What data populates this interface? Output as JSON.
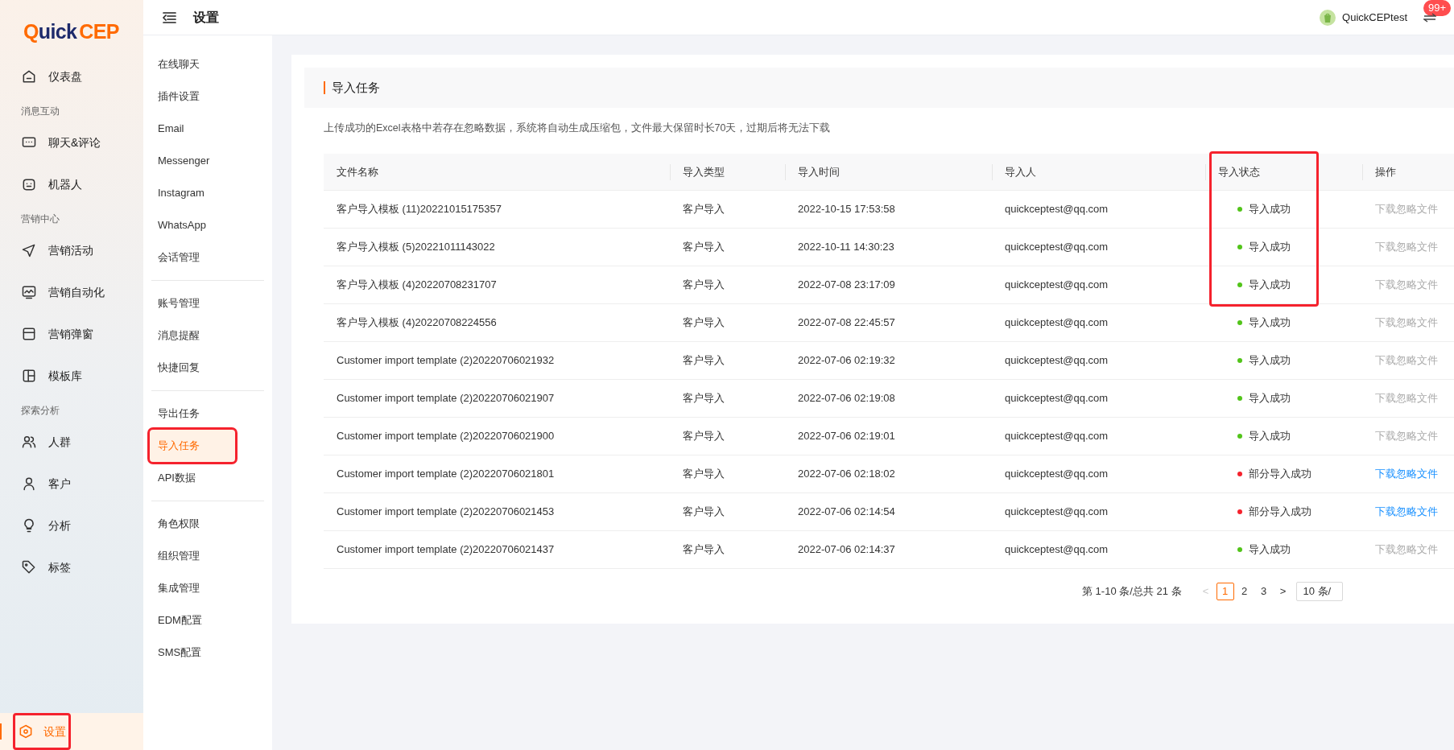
{
  "logo": {
    "first": "Q",
    "middle": "uick",
    "last": "CEP"
  },
  "sidebar": {
    "items": [
      {
        "kind": "item",
        "label": "仪表盘",
        "selected": false,
        "annotated": false
      },
      {
        "kind": "group",
        "label": "消息互动"
      },
      {
        "kind": "item",
        "label": "聊天&评论",
        "selected": false,
        "annotated": false
      },
      {
        "kind": "item",
        "label": "机器人",
        "selected": false,
        "annotated": false
      },
      {
        "kind": "group",
        "label": "营销中心"
      },
      {
        "kind": "item",
        "label": "营销活动",
        "selected": false,
        "annotated": false
      },
      {
        "kind": "item",
        "label": "营销自动化",
        "selected": false,
        "annotated": false
      },
      {
        "kind": "item",
        "label": "营销弹窗",
        "selected": false,
        "annotated": false
      },
      {
        "kind": "item",
        "label": "模板库",
        "selected": false,
        "annotated": false
      },
      {
        "kind": "group",
        "label": "探索分析"
      },
      {
        "kind": "item",
        "label": "人群",
        "selected": false,
        "annotated": false
      },
      {
        "kind": "item",
        "label": "客户",
        "selected": false,
        "annotated": false
      },
      {
        "kind": "item",
        "label": "分析",
        "selected": false,
        "annotated": false
      },
      {
        "kind": "item",
        "label": "标签",
        "selected": false,
        "annotated": false
      }
    ],
    "footer_item": {
      "label": "设置",
      "selected": true,
      "annotated": true
    }
  },
  "header": {
    "title": "设置",
    "shop": "QuickCEPtest",
    "badge": "99+"
  },
  "subnav": {
    "groups": [
      [
        {
          "label": "在线聊天",
          "selected": false,
          "annotated": false
        },
        {
          "label": "插件设置",
          "selected": false,
          "annotated": false
        },
        {
          "label": "Email",
          "selected": false,
          "annotated": false
        },
        {
          "label": "Messenger",
          "selected": false,
          "annotated": false
        },
        {
          "label": "Instagram",
          "selected": false,
          "annotated": false
        },
        {
          "label": "WhatsApp",
          "selected": false,
          "annotated": false
        },
        {
          "label": "会话管理",
          "selected": false,
          "annotated": false
        }
      ],
      [
        {
          "label": "账号管理",
          "selected": false,
          "annotated": false
        },
        {
          "label": "消息提醒",
          "selected": false,
          "annotated": false
        },
        {
          "label": "快捷回复",
          "selected": false,
          "annotated": false
        }
      ],
      [
        {
          "label": "导出任务",
          "selected": false,
          "annotated": false
        },
        {
          "label": "导入任务",
          "selected": true,
          "annotated": true
        },
        {
          "label": "API数据",
          "selected": false,
          "annotated": false
        }
      ],
      [
        {
          "label": "角色权限",
          "selected": false,
          "annotated": false
        },
        {
          "label": "组织管理",
          "selected": false,
          "annotated": false
        },
        {
          "label": "集成管理",
          "selected": false,
          "annotated": false
        },
        {
          "label": "EDM配置",
          "selected": false,
          "annotated": false
        },
        {
          "label": "SMS配置",
          "selected": false,
          "annotated": false
        }
      ]
    ]
  },
  "card": {
    "title": "导入任务",
    "note": "上传成功的Excel表格中若存在忽略数据，系统将自动生成压缩包，文件最大保留时长70天，过期后将无法下载"
  },
  "table": {
    "columns": [
      {
        "label": "文件名称"
      },
      {
        "label": "导入类型"
      },
      {
        "label": "导入时间"
      },
      {
        "label": "导入人"
      },
      {
        "label": "导入状态",
        "annotated": true
      },
      {
        "label": "操作"
      }
    ],
    "rows": [
      {
        "name": "客户导入模板 (11)20221015175357",
        "type": "客户导入",
        "time": "2022-10-15 17:53:58",
        "user": "quickceptest@qq.com",
        "status": "导入成功",
        "color": "#52c41a",
        "action": "下载忽略文件",
        "enabled": false,
        "annotated": true
      },
      {
        "name": "客户导入模板 (5)20221011143022",
        "type": "客户导入",
        "time": "2022-10-11 14:30:23",
        "user": "quickceptest@qq.com",
        "status": "导入成功",
        "color": "#52c41a",
        "action": "下载忽略文件",
        "enabled": false,
        "annotated": true
      },
      {
        "name": "客户导入模板 (4)20220708231707",
        "type": "客户导入",
        "time": "2022-07-08 23:17:09",
        "user": "quickceptest@qq.com",
        "status": "导入成功",
        "color": "#52c41a",
        "action": "下载忽略文件",
        "enabled": false,
        "annotated": true
      },
      {
        "name": "客户导入模板 (4)20220708224556",
        "type": "客户导入",
        "time": "2022-07-08 22:45:57",
        "user": "quickceptest@qq.com",
        "status": "导入成功",
        "color": "#52c41a",
        "action": "下载忽略文件",
        "enabled": false
      },
      {
        "name": "Customer import template (2)20220706021932",
        "type": "客户导入",
        "time": "2022-07-06 02:19:32",
        "user": "quickceptest@qq.com",
        "status": "导入成功",
        "color": "#52c41a",
        "action": "下载忽略文件",
        "enabled": false
      },
      {
        "name": "Customer import template (2)20220706021907",
        "type": "客户导入",
        "time": "2022-07-06 02:19:08",
        "user": "quickceptest@qq.com",
        "status": "导入成功",
        "color": "#52c41a",
        "action": "下载忽略文件",
        "enabled": false
      },
      {
        "name": "Customer import template (2)20220706021900",
        "type": "客户导入",
        "time": "2022-07-06 02:19:01",
        "user": "quickceptest@qq.com",
        "status": "导入成功",
        "color": "#52c41a",
        "action": "下载忽略文件",
        "enabled": false
      },
      {
        "name": "Customer import template (2)20220706021801",
        "type": "客户导入",
        "time": "2022-07-06 02:18:02",
        "user": "quickceptest@qq.com",
        "status": "部分导入成功",
        "color": "#f5222d",
        "action": "下载忽略文件",
        "enabled": true
      },
      {
        "name": "Customer import template (2)20220706021453",
        "type": "客户导入",
        "time": "2022-07-06 02:14:54",
        "user": "quickceptest@qq.com",
        "status": "部分导入成功",
        "color": "#f5222d",
        "action": "下载忽略文件",
        "enabled": true
      },
      {
        "name": "Customer import template (2)20220706021437",
        "type": "客户导入",
        "time": "2022-07-06 02:14:37",
        "user": "quickceptest@qq.com",
        "status": "导入成功",
        "color": "#52c41a",
        "action": "下载忽略文件",
        "enabled": false
      }
    ]
  },
  "pagination": {
    "summary": "第 1-10 条/总共 21 条",
    "prev": "<",
    "next": ">",
    "prev_disabled": true,
    "pages": [
      {
        "label": "1",
        "selected": true
      },
      {
        "label": "2",
        "selected": false
      },
      {
        "label": "3",
        "selected": false
      }
    ],
    "page_size": "10 条/"
  }
}
